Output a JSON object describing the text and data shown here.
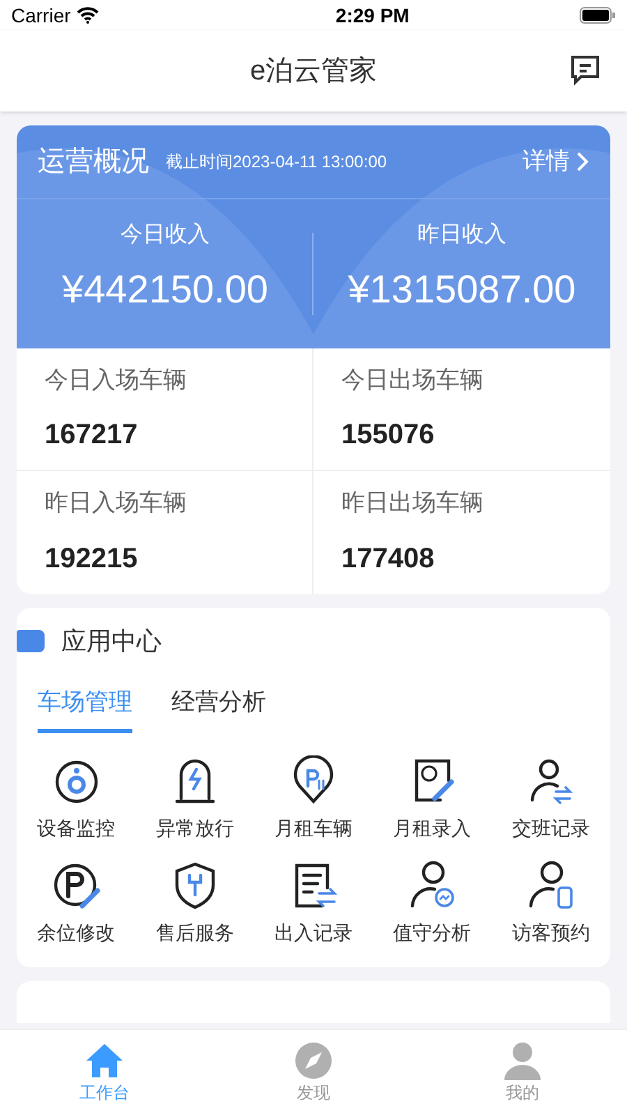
{
  "status_bar": {
    "carrier": "Carrier",
    "time": "2:29 PM"
  },
  "header": {
    "title": "e泊云管家"
  },
  "overview": {
    "title": "运营概况",
    "deadline": "截止时间2023-04-11 13:00:00",
    "details": "详情",
    "income": [
      {
        "label": "今日收入",
        "value": "¥442150.00"
      },
      {
        "label": "昨日收入",
        "value": "¥1315087.00"
      }
    ],
    "stats": [
      {
        "label": "今日入场车辆",
        "value": "167217"
      },
      {
        "label": "今日出场车辆",
        "value": "155076"
      },
      {
        "label": "昨日入场车辆",
        "value": "192215"
      },
      {
        "label": "昨日出场车辆",
        "value": "177408"
      }
    ]
  },
  "app_center": {
    "title": "应用中心",
    "tabs": [
      {
        "label": "车场管理",
        "selected": true
      },
      {
        "label": "经营分析",
        "selected": false
      }
    ],
    "apps": [
      {
        "label": "设备监控"
      },
      {
        "label": "异常放行"
      },
      {
        "label": "月租车辆"
      },
      {
        "label": "月租录入"
      },
      {
        "label": "交班记录"
      },
      {
        "label": "余位修改"
      },
      {
        "label": "售后服务"
      },
      {
        "label": "出入记录"
      },
      {
        "label": "值守分析"
      },
      {
        "label": "访客预约"
      }
    ]
  },
  "tab_bar": [
    {
      "label": "工作台",
      "selected": true
    },
    {
      "label": "发现",
      "selected": false
    },
    {
      "label": "我的",
      "selected": false
    }
  ]
}
